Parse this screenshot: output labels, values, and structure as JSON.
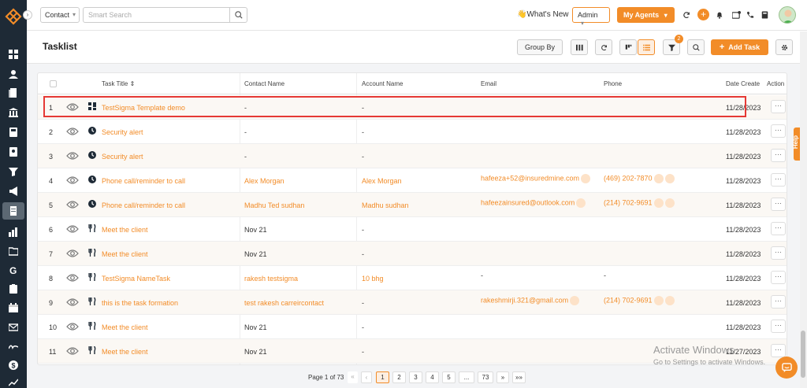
{
  "header": {
    "contact_select": "Contact",
    "search_placeholder": "Smart Search",
    "whats_new": "👋What's New",
    "admin": "Admin",
    "my_agents": "My Agents"
  },
  "toolbar": {
    "title": "Tasklist",
    "group_by": "Group By",
    "filter_count": "2",
    "add_task": "Add Task"
  },
  "table": {
    "headers": {
      "title": "Task Title ⇕",
      "contact": "Contact Name",
      "account": "Account Name",
      "email": "Email",
      "phone": "Phone",
      "date": "Date Create",
      "action": "Action"
    },
    "rows": [
      {
        "num": "1",
        "icon": "grid-icon",
        "title": "TestSigma Template demo",
        "contact": "-",
        "account": "-",
        "email": "",
        "phone": "",
        "date": "11/28/2023",
        "action": "···"
      },
      {
        "num": "2",
        "icon": "clock-icon",
        "title": "Security alert",
        "contact": "-",
        "account": "-",
        "email": "",
        "phone": "",
        "date": "11/28/2023",
        "action": "···"
      },
      {
        "num": "3",
        "icon": "clock-icon",
        "title": "Security alert",
        "contact": "-",
        "account": "-",
        "email": "",
        "phone": "",
        "date": "11/28/2023",
        "action": "···"
      },
      {
        "num": "4",
        "icon": "clock-icon",
        "title": "Phone call/reminder to call",
        "contact": "Alex Morgan",
        "account": "Alex Morgan",
        "email": "hafeeza+52@insuredmine.com",
        "phone": "(469) 202-7870",
        "date": "11/28/2023",
        "action": "···"
      },
      {
        "num": "5",
        "icon": "clock-icon",
        "title": "Phone call/reminder to call",
        "contact": "Madhu Ted sudhan",
        "account": "Madhu sudhan",
        "email": "hafeezainsured@outlook.com",
        "phone": "(214) 702-9691",
        "date": "11/28/2023",
        "action": "···"
      },
      {
        "num": "6",
        "icon": "fork-knife-icon",
        "title": "Meet the client",
        "contact": "Nov 21",
        "account": "-",
        "email": "",
        "phone": "",
        "date": "11/28/2023",
        "action": "···"
      },
      {
        "num": "7",
        "icon": "fork-knife-icon",
        "title": "Meet the client",
        "contact": "Nov 21",
        "account": "-",
        "email": "",
        "phone": "",
        "date": "11/28/2023",
        "action": "···"
      },
      {
        "num": "8",
        "icon": "fork-knife-icon",
        "title": "TestSigma NameTask",
        "contact": "rakesh testsigma",
        "account": "10 bhg",
        "email": "-",
        "phone": "-",
        "date": "11/28/2023",
        "action": "···"
      },
      {
        "num": "9",
        "icon": "fork-knife-icon",
        "title": "this is the task formation",
        "contact": "test rakesh carreircontact",
        "account": "-",
        "email": "rakeshmirji.321@gmail.com",
        "phone": "(214) 702-9691",
        "date": "11/28/2023",
        "action": "···"
      },
      {
        "num": "10",
        "icon": "fork-knife-icon",
        "title": "Meet the client",
        "contact": "Nov 21",
        "account": "-",
        "email": "",
        "phone": "",
        "date": "11/28/2023",
        "action": "···"
      },
      {
        "num": "11",
        "icon": "fork-knife-icon",
        "title": "Meet the client",
        "contact": "Nov 21",
        "account": "-",
        "email": "",
        "phone": "",
        "date": "11/27/2023",
        "action": "···"
      }
    ]
  },
  "pagination": {
    "info": "Page 1 of 73",
    "first": "«",
    "prev": "‹",
    "pages": [
      "1",
      "2",
      "3",
      "4",
      "5",
      "...",
      "73"
    ],
    "next": "»",
    "last": "»»"
  },
  "help": "Help",
  "watermark": {
    "line1": "Activate Windows",
    "line2": "Go to Settings to activate Windows."
  },
  "colors": {
    "accent": "#f28c28",
    "sidebar": "#1e2a36",
    "highlight": "#e53935"
  }
}
